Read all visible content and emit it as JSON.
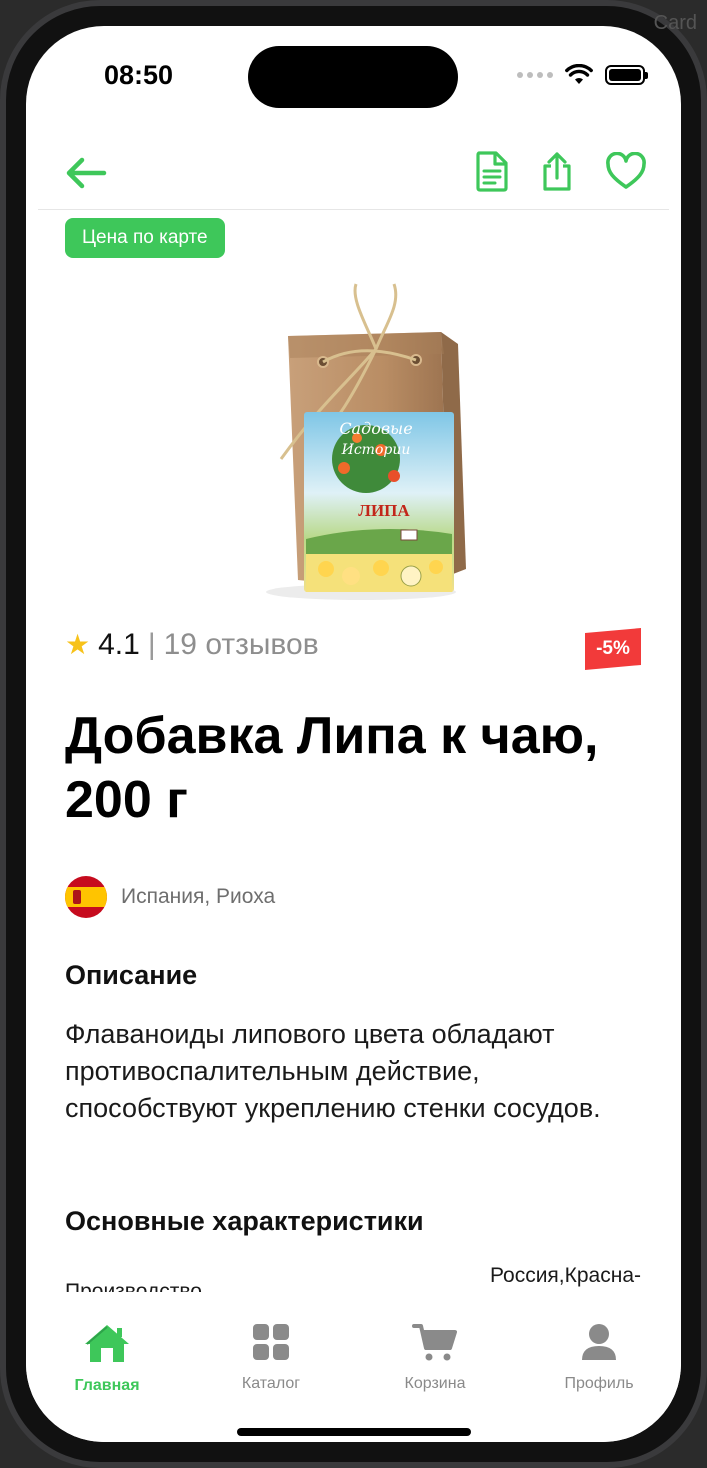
{
  "status_bar": {
    "time": "08:50"
  },
  "background_ghost": "Card",
  "nav": {
    "back_icon": "arrow-left-icon",
    "actions": [
      "document-icon",
      "share-icon",
      "heart-icon"
    ]
  },
  "colors": {
    "accent": "#3ec75a",
    "discount": "#f23a3a",
    "star": "#f7c21a"
  },
  "product": {
    "card_price_label": "Цена по карте",
    "image_brand_text": "САДОВЫЕ ИСТОРИИ",
    "image_product_text": "ЛИПА",
    "rating": "4.1",
    "rating_separator": "|",
    "reviews": "19 отзывов",
    "discount": "-5%",
    "title": "Добавка Липа к чаю, 200 г",
    "origin": "Испания, Риоха",
    "description_title": "Описание",
    "description": "Флаваноиды липового цвета обладают противоспалительным действие, способствуют укреплению стенки сосудов.",
    "specs_title": "Основные характеристики",
    "specs": [
      {
        "label": "Производство",
        "value": "Россия,Красна-"
      }
    ]
  },
  "tabbar": {
    "items": [
      {
        "label": "Главная",
        "icon": "home-icon",
        "active": true
      },
      {
        "label": "Каталог",
        "icon": "grid-icon",
        "active": false
      },
      {
        "label": "Корзина",
        "icon": "cart-icon",
        "active": false
      },
      {
        "label": "Профиль",
        "icon": "profile-icon",
        "active": false
      }
    ]
  }
}
